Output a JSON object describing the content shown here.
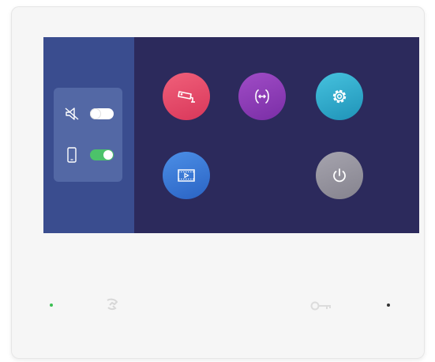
{
  "device": {
    "name": "",
    "screen": {
      "left_panel": {
        "toggles": [
          {
            "icon": "mute-speaker-icon",
            "state": "off"
          },
          {
            "icon": "mobile-phone-icon",
            "state": "on"
          }
        ]
      },
      "apps": [
        {
          "icon": "cctv-camera-icon",
          "color": "#e44b69"
        },
        {
          "icon": "intercom-transfer-icon",
          "color": "#8c3cb8"
        },
        {
          "icon": "gear-icon",
          "color": "#2ea9cc"
        },
        {
          "icon": "video-playback-icon",
          "color": "#3b78d6"
        },
        {
          "icon": "power-icon",
          "color": "#96949e"
        }
      ]
    },
    "hardware": {
      "talk_button_icon": "talk-icon",
      "unlock_button_icon": "key-icon",
      "led_left_color": "#3bbf52",
      "led_right_color": "#333333"
    }
  },
  "colors": {
    "screen_bg": "#2c2a5c",
    "panel_bg": "#3a4d8f",
    "card_bg": "#5368a5",
    "toggle_on": "#4cc26a"
  }
}
